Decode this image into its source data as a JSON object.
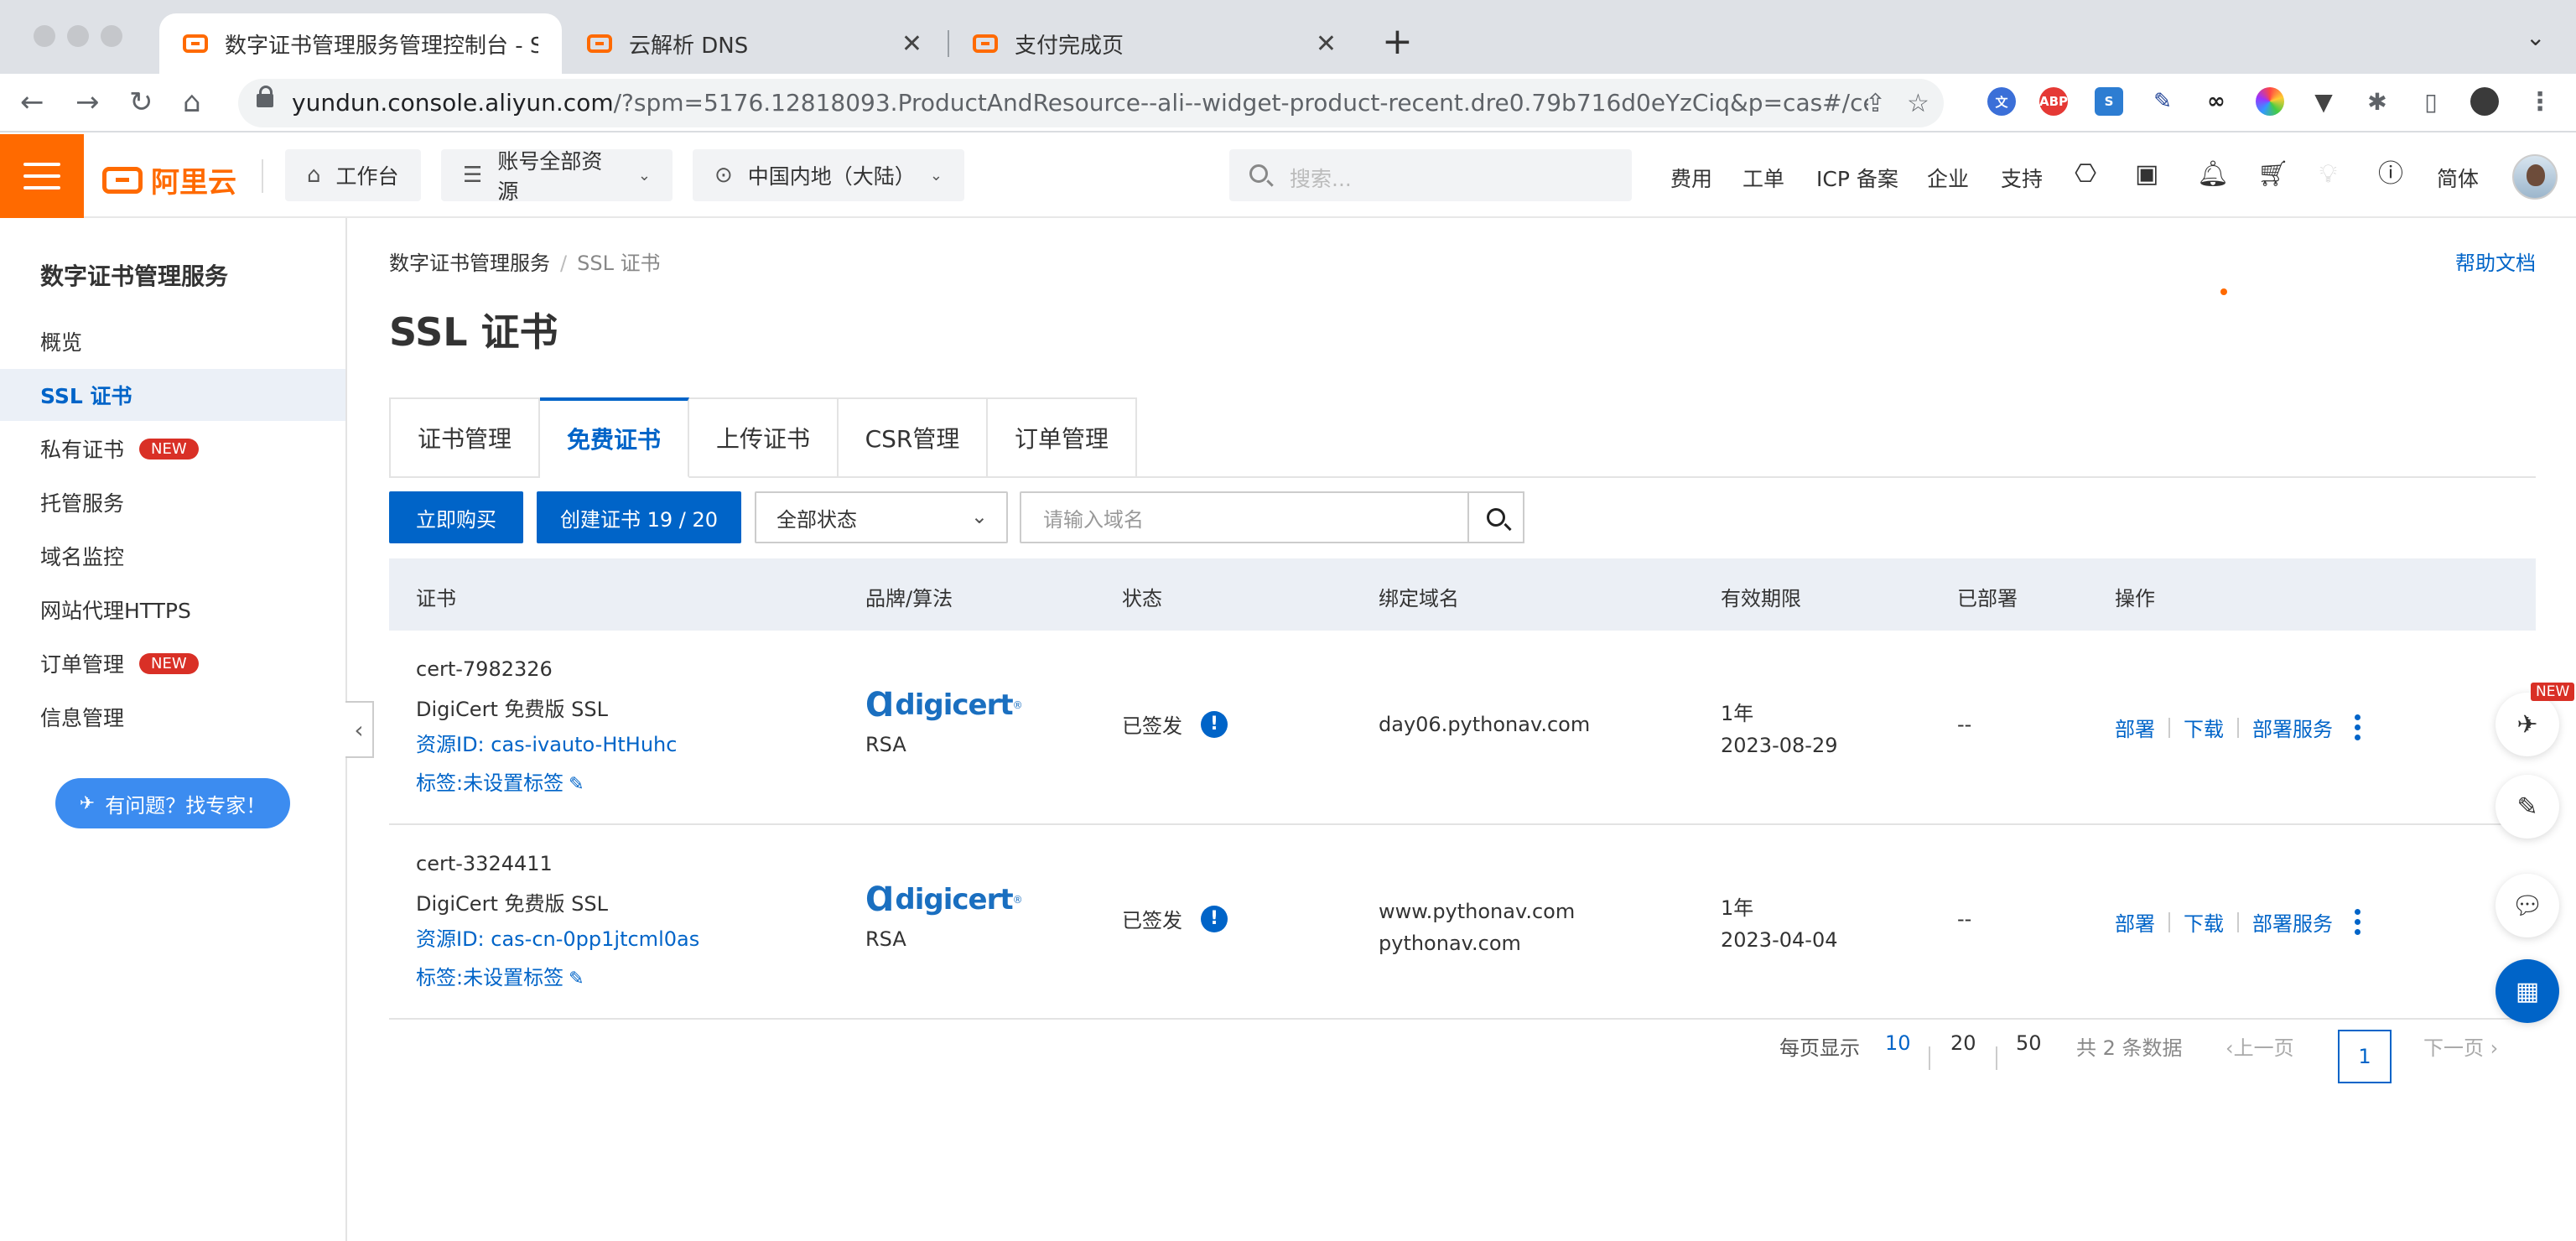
{
  "browser": {
    "tabs": [
      {
        "title": "数字证书管理服务管理控制台 - S"
      },
      {
        "title": "云解析 DNS"
      },
      {
        "title": "支付完成页"
      }
    ],
    "url_host": "yundun.console.aliyun.com",
    "url_path": "/?spm=5176.12818093.ProductAndResource--ali--widget-product-recent.dre0.79b716d0eYzCiq&p=cas#/certE...",
    "extensions": [
      "ABP",
      "S",
      "$"
    ]
  },
  "topnav": {
    "logo": "阿里云",
    "workbench": "工作台",
    "resources": "账号全部资源",
    "region": "中国内地（大陆）",
    "search_placeholder": "搜索...",
    "links": [
      "费用",
      "工单",
      "ICP 备案",
      "企业",
      "支持"
    ],
    "language": "简体"
  },
  "sidebar": {
    "title": "数字证书管理服务",
    "items": [
      {
        "label": "概览"
      },
      {
        "label": "SSL 证书"
      },
      {
        "label": "私有证书",
        "badge": "NEW"
      },
      {
        "label": "托管服务"
      },
      {
        "label": "域名监控"
      },
      {
        "label": "网站代理HTTPS"
      },
      {
        "label": "订单管理",
        "badge": "NEW"
      },
      {
        "label": "信息管理"
      }
    ],
    "help_button": "有问题？找专家！"
  },
  "main": {
    "breadcrumb": [
      "数字证书管理服务",
      "SSL 证书"
    ],
    "help_doc": "帮助文档",
    "title": "SSL 证书",
    "tabs": [
      "证书管理",
      "免费证书",
      "上传证书",
      "CSR管理",
      "订单管理"
    ],
    "buy_button": "立即购买",
    "create_button": "创建证书 19 / 20",
    "status_select": "全部状态",
    "domain_placeholder": "请输入域名",
    "columns": [
      "证书",
      "品牌/算法",
      "状态",
      "绑定域名",
      "有效期限",
      "已部署",
      "操作"
    ],
    "rows": [
      {
        "name": "cert-7982326",
        "type": "DigiCert 免费版 SSL",
        "resource_id": "资源ID: cas-ivauto-HtHuhc",
        "tag": "标签:未设置标签",
        "brand": "digicert",
        "algorithm": "RSA",
        "status": "已签发",
        "domains": [
          "day06.pythonav.com"
        ],
        "validity": "1年",
        "expiry": "2023-08-29",
        "deployed": "--",
        "actions": [
          "部署",
          "下载",
          "部署服务"
        ]
      },
      {
        "name": "cert-3324411",
        "type": "DigiCert 免费版 SSL",
        "resource_id": "资源ID: cas-cn-0pp1jtcml0as",
        "tag": "标签:未设置标签",
        "brand": "digicert",
        "algorithm": "RSA",
        "status": "已签发",
        "domains": [
          "www.pythonav.com",
          "pythonav.com"
        ],
        "validity": "1年",
        "expiry": "2023-04-04",
        "deployed": "--",
        "actions": [
          "部署",
          "下载",
          "部署服务"
        ]
      }
    ],
    "pagination": {
      "per_page_label": "每页显示",
      "sizes": [
        "10",
        "20",
        "50"
      ],
      "total": "共 2 条数据",
      "prev": "上一页",
      "current": "1",
      "next": "下一页"
    }
  },
  "floating": {
    "new_badge": "NEW"
  },
  "colors": {
    "brand": "#ff6a00",
    "primary": "#0064c8",
    "badge": "#d93026"
  }
}
